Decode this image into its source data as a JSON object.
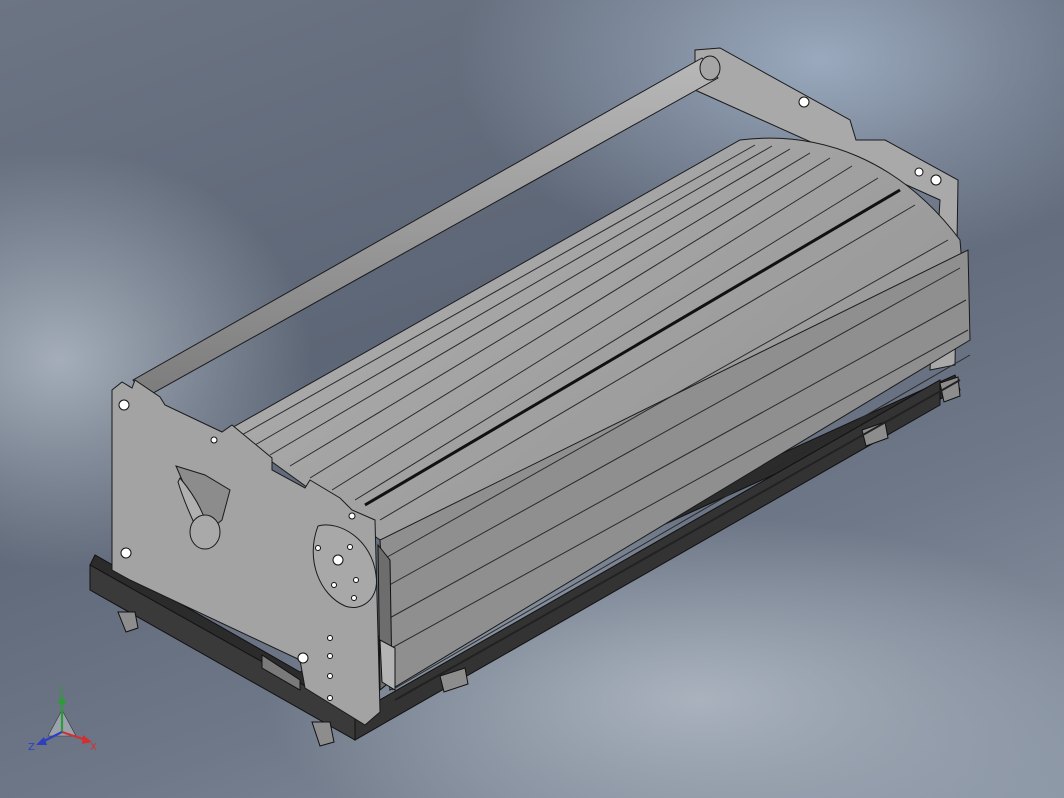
{
  "viewport": {
    "background_top": "#6c7584",
    "background_bottom": "#8e99a8"
  },
  "model": {
    "type": "3d-isometric-part",
    "body_color": "#9a9a9a",
    "edge_color": "#1a1a1a",
    "base_color": "#2c2c2c"
  },
  "triad": {
    "y_label": "Y",
    "x_label": "X",
    "z_label": "Z",
    "y_color": "#2f9a3a",
    "x_color": "#d23030",
    "z_color": "#2d3fbf"
  }
}
